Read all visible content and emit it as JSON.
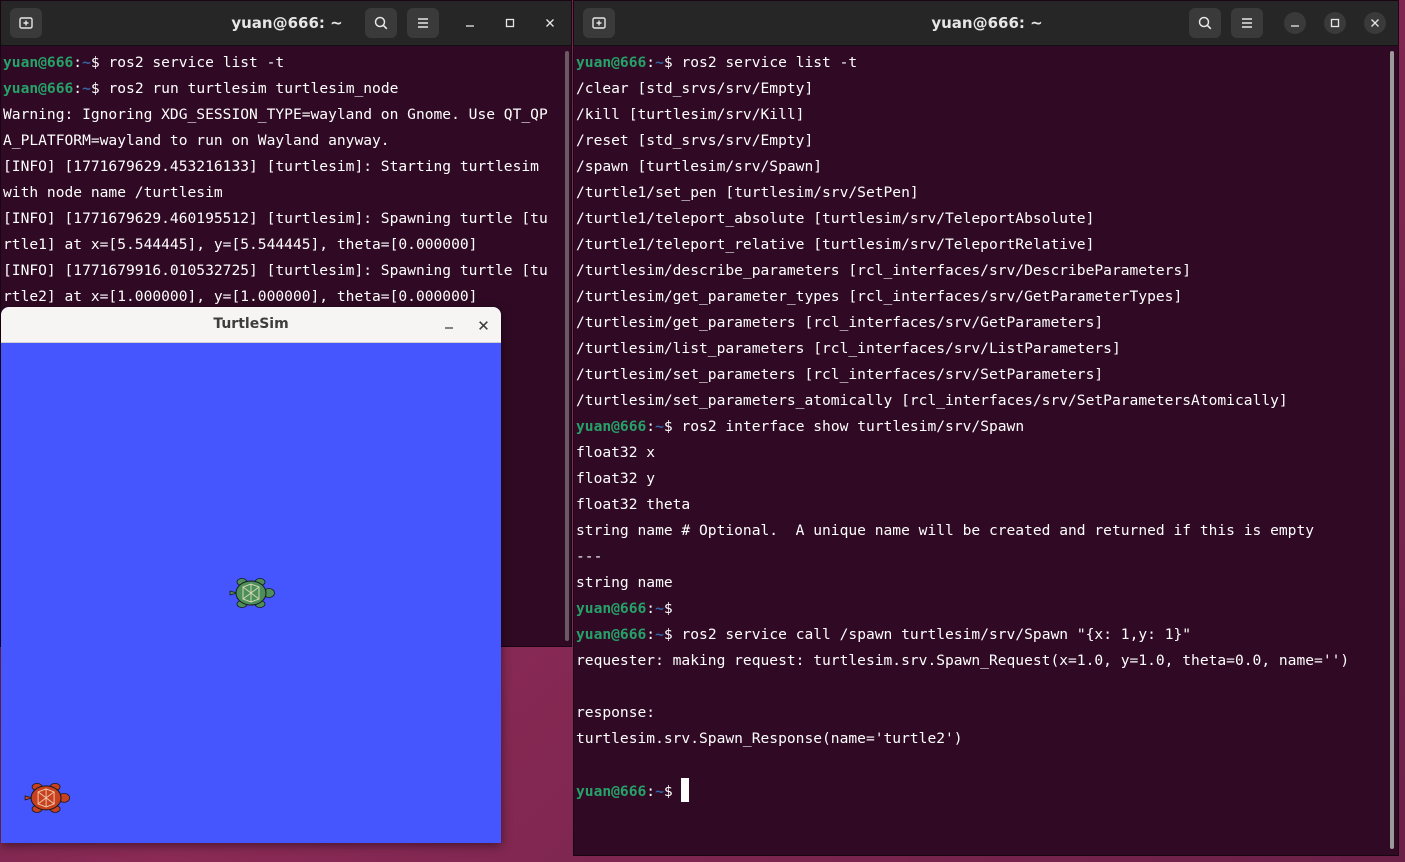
{
  "left_terminal": {
    "title": "yuan@666: ~",
    "lines": [
      {
        "prompt": true,
        "user": "yuan@666",
        "path": "~",
        "cmd": "ros2 service list -t"
      },
      {
        "prompt": true,
        "user": "yuan@666",
        "path": "~",
        "cmd": "ros2 run turtlesim turtlesim_node"
      },
      {
        "text": "Warning: Ignoring XDG_SESSION_TYPE=wayland on Gnome. Use QT_QP"
      },
      {
        "text": "A_PLATFORM=wayland to run on Wayland anyway."
      },
      {
        "text": "[INFO] [1771679629.453216133] [turtlesim]: Starting turtlesim"
      },
      {
        "text": "with node name /turtlesim"
      },
      {
        "text": "[INFO] [1771679629.460195512] [turtlesim]: Spawning turtle [tu"
      },
      {
        "text": "rtle1] at x=[5.544445], y=[5.544445], theta=[0.000000]"
      },
      {
        "text": "[INFO] [1771679916.010532725] [turtlesim]: Spawning turtle [tu"
      },
      {
        "text": "rtle2] at x=[1.000000], y=[1.000000], theta=[0.000000]"
      }
    ]
  },
  "right_terminal": {
    "title": "yuan@666: ~",
    "lines": [
      {
        "prompt": true,
        "user": "yuan@666",
        "path": "~",
        "cmd": "ros2 service list -t"
      },
      {
        "text": "/clear [std_srvs/srv/Empty]"
      },
      {
        "text": "/kill [turtlesim/srv/Kill]"
      },
      {
        "text": "/reset [std_srvs/srv/Empty]"
      },
      {
        "text": "/spawn [turtlesim/srv/Spawn]"
      },
      {
        "text": "/turtle1/set_pen [turtlesim/srv/SetPen]"
      },
      {
        "text": "/turtle1/teleport_absolute [turtlesim/srv/TeleportAbsolute]"
      },
      {
        "text": "/turtle1/teleport_relative [turtlesim/srv/TeleportRelative]"
      },
      {
        "text": "/turtlesim/describe_parameters [rcl_interfaces/srv/DescribeParameters]"
      },
      {
        "text": "/turtlesim/get_parameter_types [rcl_interfaces/srv/GetParameterTypes]"
      },
      {
        "text": "/turtlesim/get_parameters [rcl_interfaces/srv/GetParameters]"
      },
      {
        "text": "/turtlesim/list_parameters [rcl_interfaces/srv/ListParameters]"
      },
      {
        "text": "/turtlesim/set_parameters [rcl_interfaces/srv/SetParameters]"
      },
      {
        "text": "/turtlesim/set_parameters_atomically [rcl_interfaces/srv/SetParametersAtomically]"
      },
      {
        "prompt": true,
        "user": "yuan@666",
        "path": "~",
        "cmd": "ros2 interface show turtlesim/srv/Spawn"
      },
      {
        "text": "float32 x"
      },
      {
        "text": "float32 y"
      },
      {
        "text": "float32 theta"
      },
      {
        "text": "string name # Optional.  A unique name will be created and returned if this is empty"
      },
      {
        "text": "---"
      },
      {
        "text": "string name"
      },
      {
        "prompt": true,
        "user": "yuan@666",
        "path": "~",
        "cmd": ""
      },
      {
        "prompt": true,
        "user": "yuan@666",
        "path": "~",
        "cmd": "ros2 service call /spawn turtlesim/srv/Spawn \"{x: 1,y: 1}\""
      },
      {
        "text": "requester: making request: turtlesim.srv.Spawn_Request(x=1.0, y=1.0, theta=0.0, name='')"
      },
      {
        "text": ""
      },
      {
        "text": "response:"
      },
      {
        "text": "turtlesim.srv.Spawn_Response(name='turtle2')"
      },
      {
        "text": ""
      },
      {
        "prompt": true,
        "user": "yuan@666",
        "path": "~",
        "cmd": "",
        "cursor": true
      }
    ]
  },
  "turtlesim": {
    "title": "TurtleSim",
    "background": "#4556ff",
    "turtles": [
      {
        "name": "turtle1",
        "x": 5.544445,
        "y": 5.544445,
        "color": "#4c8f5a"
      },
      {
        "name": "turtle2",
        "x": 1.0,
        "y": 1.0,
        "color": "#c8401f"
      }
    ],
    "world_size": 11.088889
  },
  "colors": {
    "terminal_bg": "#300a24",
    "prompt_user": "#26a269",
    "prompt_path": "#3465a4",
    "titlebar": "#262626"
  }
}
